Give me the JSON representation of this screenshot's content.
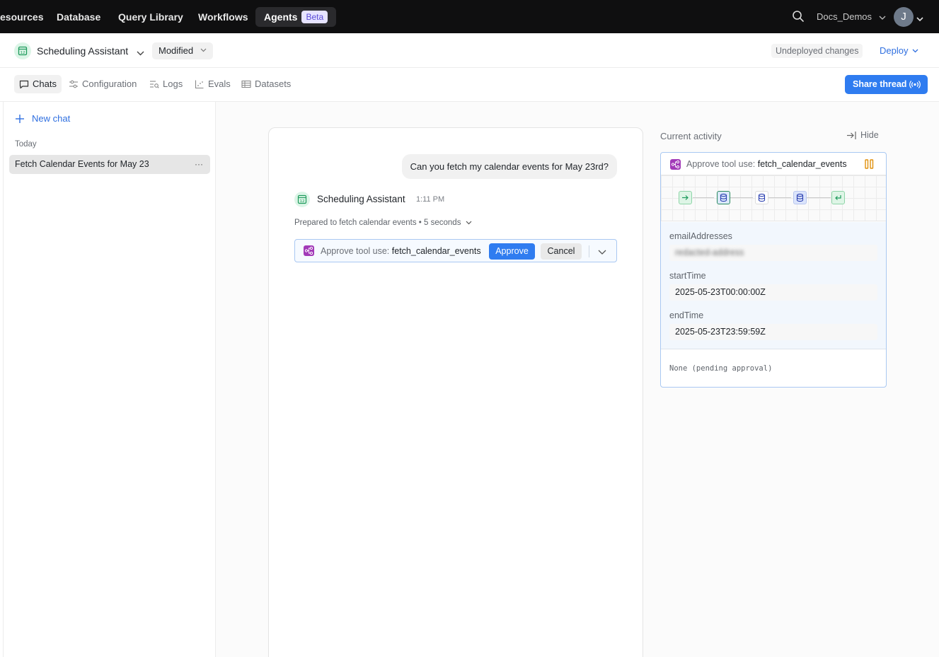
{
  "topnav": {
    "items": [
      {
        "label": "esources",
        "active": false
      },
      {
        "label": "Database",
        "active": false
      },
      {
        "label": "Query Library",
        "active": false
      },
      {
        "label": "Workflows",
        "active": false
      },
      {
        "label": "Agents",
        "active": true,
        "badge": "Beta"
      }
    ],
    "org": "Docs_Demos",
    "avatar_initial": "J"
  },
  "appbar": {
    "title": "Scheduling Assistant",
    "status_button": "Modified",
    "undeployed": "Undeployed changes",
    "deploy": "Deploy"
  },
  "tabs": [
    {
      "label": "Chats",
      "icon": "chat-icon",
      "active": true
    },
    {
      "label": "Configuration",
      "icon": "sliders-icon",
      "active": false
    },
    {
      "label": "Logs",
      "icon": "logs-icon",
      "active": false
    },
    {
      "label": "Evals",
      "icon": "chart-icon",
      "active": false
    },
    {
      "label": "Datasets",
      "icon": "table-icon",
      "active": false
    }
  ],
  "share_button": "Share thread",
  "sidebar": {
    "new_chat": "New chat",
    "section_label": "Today",
    "chats": [
      {
        "title": "Fetch Calendar Events for May 23",
        "selected": true
      }
    ],
    "more": "···"
  },
  "chat": {
    "user_message": "Can you fetch my calendar events for May 23rd?",
    "assistant_name": "Scheduling Assistant",
    "assistant_time": "1:11 PM",
    "prepared": "Prepared to fetch calendar events • 5 seconds",
    "approval": {
      "prefix": "Approve tool use:",
      "tool_name": "fetch_calendar_events",
      "approve": "Approve",
      "cancel": "Cancel"
    }
  },
  "activity": {
    "title": "Current activity",
    "hide": "Hide",
    "header_prefix": "Approve tool use:",
    "tool_name": "fetch_calendar_events",
    "flow_nodes": [
      "input-arrow-icon",
      "database-icon",
      "database-icon",
      "database-icon",
      "return-icon"
    ],
    "params": [
      {
        "label": "emailAddresses",
        "value": "redacted-address",
        "blurred": true
      },
      {
        "label": "startTime",
        "value": "2025-05-23T00:00:00Z",
        "blurred": false
      },
      {
        "label": "endTime",
        "value": "2025-05-23T23:59:59Z",
        "blurred": false
      }
    ],
    "result": "None (pending approval)"
  },
  "colors": {
    "accent": "#2f7cf0",
    "link": "#2f6fe0",
    "tool_icon": "#a23ab8",
    "nav_bg": "#0f0f10",
    "beta_bg": "#e6e3ff",
    "beta_text": "#5a4bd6",
    "paused_icon": "#e0900b"
  }
}
